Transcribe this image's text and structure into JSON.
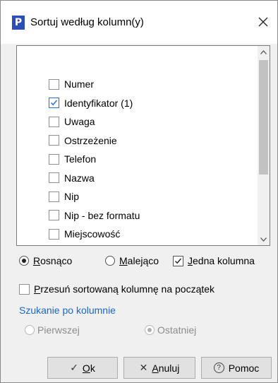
{
  "dialog": {
    "icon_letter": "P",
    "title": "Sortuj według kolumn(y)",
    "close_glyph": "✕"
  },
  "columns": [
    {
      "label": "Numer",
      "checked": false
    },
    {
      "label": "Identyfikator (1)",
      "checked": true
    },
    {
      "label": "Uwaga",
      "checked": false
    },
    {
      "label": "Ostrzeżenie",
      "checked": false
    },
    {
      "label": "Telefon",
      "checked": false
    },
    {
      "label": "Nazwa",
      "checked": false
    },
    {
      "label": "Nip",
      "checked": false
    },
    {
      "label": "Nip - bez formatu",
      "checked": false
    },
    {
      "label": "Miejscowość",
      "checked": false
    }
  ],
  "order": {
    "asc_first": "R",
    "asc_rest": "osnąco",
    "desc_first": "M",
    "desc_rest": "alejąco",
    "selected": "asc"
  },
  "single_column": {
    "first": "J",
    "rest": "edna kolumna",
    "checked": true
  },
  "move_to_start": {
    "first": "P",
    "rest": "rzesuń sortowaną kolumnę na początek",
    "checked": false
  },
  "search": {
    "title": "Szukanie po kolumnie",
    "first_label": "Pierwszej",
    "last_label": "Ostatniej",
    "selected": "last"
  },
  "buttons": {
    "ok_first": "O",
    "ok_rest": "k",
    "cancel_first": "A",
    "cancel_rest": "nuluj",
    "help_label": "Pomoc",
    "ok_glyph": "✓",
    "cancel_glyph": "✕",
    "help_glyph": "?"
  },
  "colors": {
    "accent": "#1a67c9",
    "icon_bg": "#2b4fb3"
  }
}
